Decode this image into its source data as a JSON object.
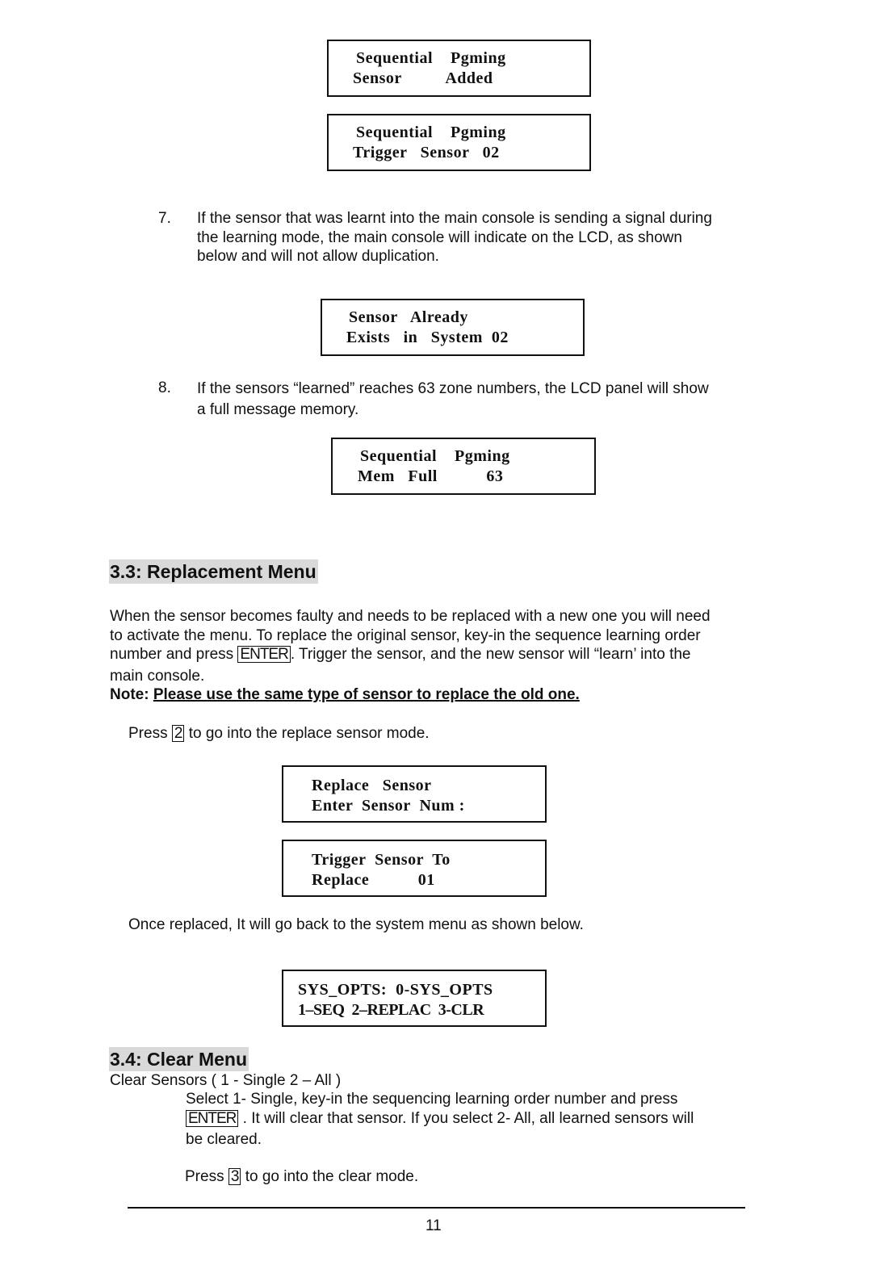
{
  "lcd_screens": {
    "seq_added": [
      "Sequential    Pgming",
      "Sensor          Added"
    ],
    "seq_trigger": [
      "Sequential    Pgming",
      "Trigger   Sensor   02"
    ],
    "already_exists": [
      "Sensor   Already",
      "Exists   in   System  02"
    ],
    "mem_full": [
      "Sequential    Pgming",
      "Mem   Full           63"
    ],
    "replace_sensor": [
      "Replace   Sensor",
      "Enter  Sensor  Num :"
    ],
    "trigger_replace": [
      "Trigger  Sensor  To",
      "Replace           01"
    ],
    "sys_opts": [
      "SYS_OPTS:  0-SYS_OPTS",
      "1–SEQ  2–REPLAC  3-CLR"
    ]
  },
  "steps": [
    {
      "number": "7.",
      "lines": [
        "If the sensor that was learnt into the main console is sending a signal during",
        "the learning mode, the main console will indicate on the LCD, as shown",
        "below and will not allow duplication."
      ]
    },
    {
      "number": "8.",
      "lines": [
        "If the sensors “learned” reaches 63 zone numbers, the LCD panel will show",
        "a full message memory."
      ]
    }
  ],
  "section_replacement": {
    "heading": "3.3: Replacement Menu",
    "para_lines": [
      "When the sensor becomes faulty and needs to be replaced with a new one you will need",
      "to activate the menu. To replace the original sensor, key-in the sequence learning order"
    ],
    "para_line3_before": "number and press ",
    "enter_key": "ENTER",
    "para_line3_after": ". Trigger the sensor, and the new sensor will “learn’  into the",
    "para_line4": "main console.",
    "note_label": "Note:",
    "note_text": "Please use the same type of sensor to replace the old one.",
    "press_before": "Press ",
    "press_key": "2",
    "press_after": " to go into the replace sensor mode.",
    "once_replaced": "Once replaced, It will go back to the system menu as shown below."
  },
  "section_clear": {
    "heading": "3.4: Clear Menu",
    "subtitle": "Clear Sensors ( 1 - Single  2 – All )",
    "line1": "Select 1- Single, key-in the sequencing learning order number and press",
    "enter_key": "ENTER",
    "line2_after": " . It will clear that sensor. If  you select 2- All, all learned sensors will",
    "line3": "be cleared.",
    "press_before": "Press ",
    "press_key": "3",
    "press_after": " to go into the clear mode."
  },
  "footer": {
    "page_number": "11"
  }
}
